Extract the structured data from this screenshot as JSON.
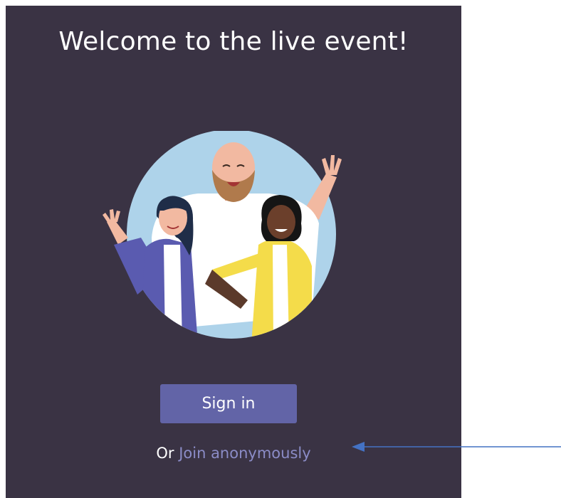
{
  "welcome": {
    "title": "Welcome to the live event!"
  },
  "illustration": {
    "icon": "welcome-people-illustration"
  },
  "signin": {
    "label": "Sign in"
  },
  "anonymous": {
    "prefix": "Or",
    "link_label": "Join anonymously"
  },
  "colors": {
    "panel_bg": "#3a3344",
    "accent": "#6264a7",
    "link": "#8b8cc7",
    "arrow": "#4472c4"
  }
}
